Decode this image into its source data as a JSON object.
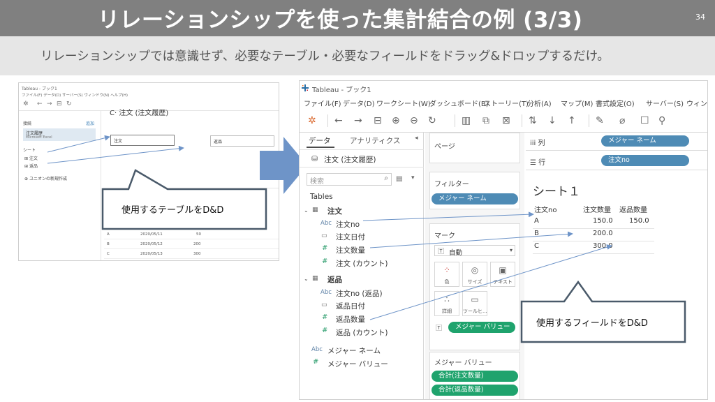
{
  "header": {
    "title": "リレーションシップを使った集計結合の例 (3/3)",
    "page_number": "34",
    "subtitle": "リレーションシップでは意識せず、必要なテーブル・必要なフィールドをドラッグ&ドロップするだけ。"
  },
  "small_screenshot": {
    "title": "Tableau - ブック1",
    "menu": "ファイル(F)  データ(D)  サーバー(S)  ウィンドウ(N)  ヘルプ(H)",
    "connection_label": "接続",
    "add_label": "追加",
    "source_name": "注文履歴",
    "source_sub": "Microsoft Excel",
    "sheets_label": "シート",
    "sheet_items": [
      "注文",
      "返品",
      "ユニオンの新規作成"
    ],
    "canvas_title": "注文 (注文履歴)",
    "box_left": "注文",
    "box_right": "返品",
    "rows": [
      {
        "c1": "A",
        "c2": "2020/05/11",
        "c3": "50"
      },
      {
        "c1": "B",
        "c2": "2020/05/12",
        "c3": "200"
      },
      {
        "c1": "C",
        "c2": "2020/05/13",
        "c3": "300"
      }
    ]
  },
  "app": {
    "window_title": "Tableau - ブック1",
    "menu": [
      "ファイル(F)",
      "データ(D)",
      "ワークシート(W)",
      "ダッシュボード(B)",
      "ストーリー(T)",
      "分析(A)",
      "マップ(M)",
      "書式設定(O)",
      "サーバー(S)",
      "ウィン"
    ],
    "data_pane": {
      "tab_data": "データ",
      "tab_analytics": "アナリティクス",
      "source_name": "注文 (注文履歴)",
      "search_placeholder": "検索",
      "tables_label": "Tables",
      "table1": {
        "name": "注文",
        "fields": [
          {
            "type": "Abc",
            "name": "注文no"
          },
          {
            "type": "date",
            "name": "注文日付"
          },
          {
            "type": "#",
            "name": "注文数量"
          },
          {
            "type": "#",
            "name": "注文 (カウント)"
          }
        ]
      },
      "table2": {
        "name": "返品",
        "fields": [
          {
            "type": "Abc",
            "name": "注文no (返品)"
          },
          {
            "type": "date",
            "name": "返品日付"
          },
          {
            "type": "#",
            "name": "返品数量"
          },
          {
            "type": "#",
            "name": "返品 (カウント)"
          }
        ]
      },
      "measure_names": "メジャー ネーム",
      "measure_values": "メジャー バリュー"
    },
    "shelves": {
      "pages_label": "ページ",
      "filters_label": "フィルター",
      "filter_pill": "メジャー ネーム",
      "marks_label": "マーク",
      "marks_type": "自動",
      "mark_buttons": [
        "色",
        "サイズ",
        "テキスト",
        "詳細",
        "ツールヒ..."
      ],
      "marks_pill": "メジャー バリュー",
      "measure_values_label": "メジャー バリュー",
      "measure_pills": [
        "合計(注文数量)",
        "合計(返品数量)"
      ]
    },
    "view": {
      "columns_label": "列",
      "rows_label": "行",
      "columns_pill": "メジャー ネーム",
      "rows_pill": "注文no",
      "sheet_title": "シート１",
      "table_headers": [
        "注文no",
        "注文数量",
        "返品数量"
      ],
      "table_rows": [
        [
          "A",
          "150.0",
          "150.0"
        ],
        [
          "B",
          "200.0",
          ""
        ],
        [
          "C",
          "300.0",
          ""
        ]
      ]
    }
  },
  "callouts": {
    "table_dd": "使用するテーブルをD&D",
    "field_dd": "使用するフィールドをD&D"
  },
  "colors": {
    "title_bar": "#808080",
    "subtitle_bar": "#e6e6e6",
    "pill_blue": "#4e8bb5",
    "pill_green": "#1fa36d",
    "arrow_blue": "#6e94c8",
    "callout_border": "#4a5a6a"
  }
}
